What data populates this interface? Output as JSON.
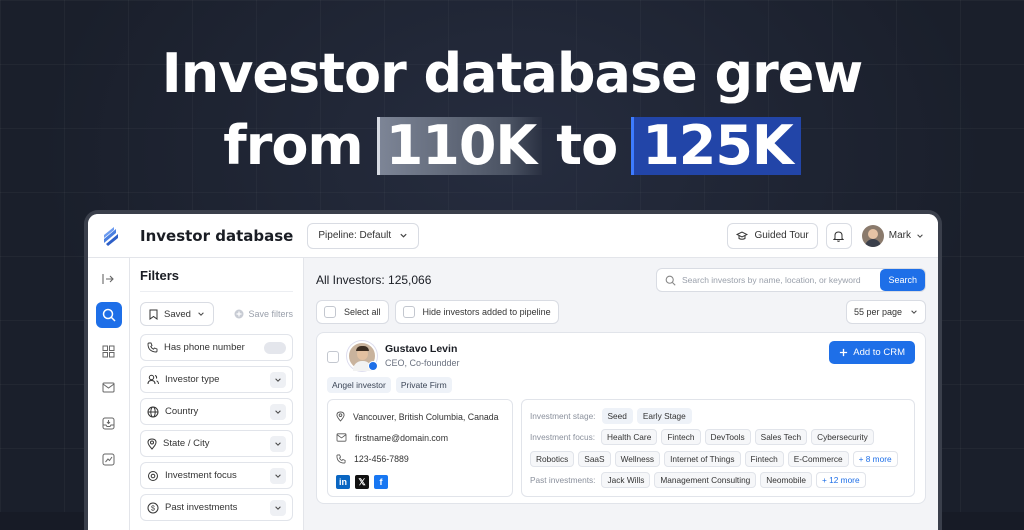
{
  "headline": {
    "line1": "Investor database grew",
    "from": "from",
    "old_value": "110K",
    "to": "to",
    "new_value": "125K"
  },
  "topbar": {
    "title": "Investor database",
    "pipeline": "Pipeline: Default",
    "guided_tour": "Guided Tour",
    "user_name": "Mark"
  },
  "filters": {
    "title": "Filters",
    "saved": "Saved",
    "save_filters": "Save filters",
    "items": [
      {
        "label": "Has phone number"
      },
      {
        "label": "Investor type"
      },
      {
        "label": "Country"
      },
      {
        "label": "State / City"
      },
      {
        "label": "Investment focus"
      },
      {
        "label": "Past investments"
      }
    ]
  },
  "main": {
    "count_label": "All Investors: 125,066",
    "search_placeholder": "Search investors by name, location, or keyword",
    "search_button": "Search",
    "select_all": "Select all",
    "hide_pipeline": "Hide investors added to pipeline",
    "per_page": "55 per page"
  },
  "card": {
    "name": "Gustavo Levin",
    "role": "CEO, Co-foundder",
    "add_crm": "Add to CRM",
    "tags": [
      "Angel investor",
      "Private Firm"
    ],
    "location": "Vancouver, British Columbia, Canada",
    "email": "firstname@domain.com",
    "phone": "123-456-7889",
    "stage_label": "Investment stage:",
    "stages": [
      "Seed",
      "Early Stage"
    ],
    "focus_label": "Investment focus:",
    "focus_row1": [
      "Health Care",
      "Fintech",
      "DevTools",
      "Sales Tech",
      "Cybersecurity"
    ],
    "focus_row2": [
      "Robotics",
      "SaaS",
      "Wellness",
      "Internet of Things",
      "Fintech",
      "E-Commerce"
    ],
    "focus_more": "+ 8 more",
    "past_label": "Past investments:",
    "past": [
      "Jack Wills",
      "Management Consulting",
      "Neomobile"
    ],
    "past_more": "+ 12 more"
  },
  "colors": {
    "accent": "#1e6fe8",
    "background": "#1a1f2b"
  }
}
